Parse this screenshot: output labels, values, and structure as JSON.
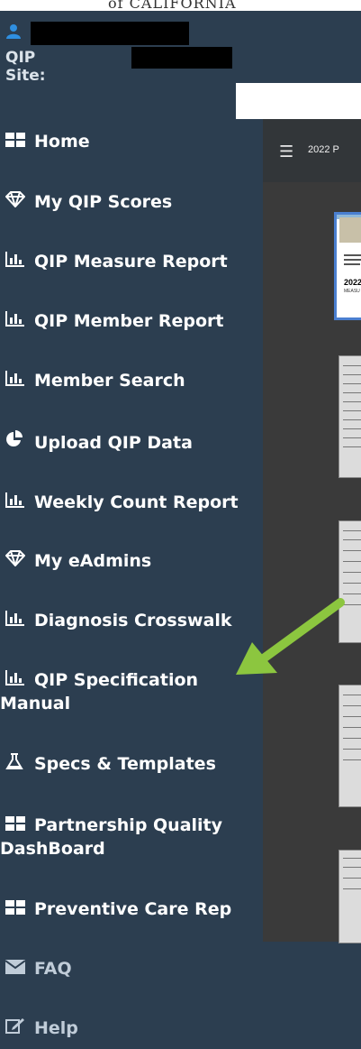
{
  "header": {
    "org_text": "of CALIFORNIA",
    "qip_site_label": "QIP Site:"
  },
  "viewer": {
    "menu_icon": "hamburger-icon",
    "title": "2022 P",
    "cover_year": "2022",
    "cover_subtitle": "MEASU"
  },
  "menu": {
    "home": "Home",
    "my_qip_scores": "My QIP Scores",
    "qip_measure_report": "QIP Measure Report",
    "qip_member_report": "QIP Member Report",
    "member_search": "Member Search",
    "upload_qip_data": "Upload QIP Data",
    "weekly_count_report": "Weekly Count Report",
    "my_eadmins": "My eAdmins",
    "diagnosis_crosswalk": "Diagnosis Crosswalk",
    "qip_specification_manual_line1": "QIP Specification",
    "qip_specification_manual_line2": "Manual",
    "specs_templates": "Specs & Templates",
    "partnership_quality_line1": "Partnership Quality",
    "partnership_quality_line2": "DashBoard",
    "preventive_care_report": "Preventive Care Rep",
    "faq": "FAQ",
    "help": "Help"
  },
  "colors": {
    "sidebar_bg": "#2c3e50",
    "menu_text": "#ffffff",
    "dim_text": "#c0ccd8",
    "arrow": "#8cc63f",
    "viewer_bg": "#3a3a3a"
  }
}
